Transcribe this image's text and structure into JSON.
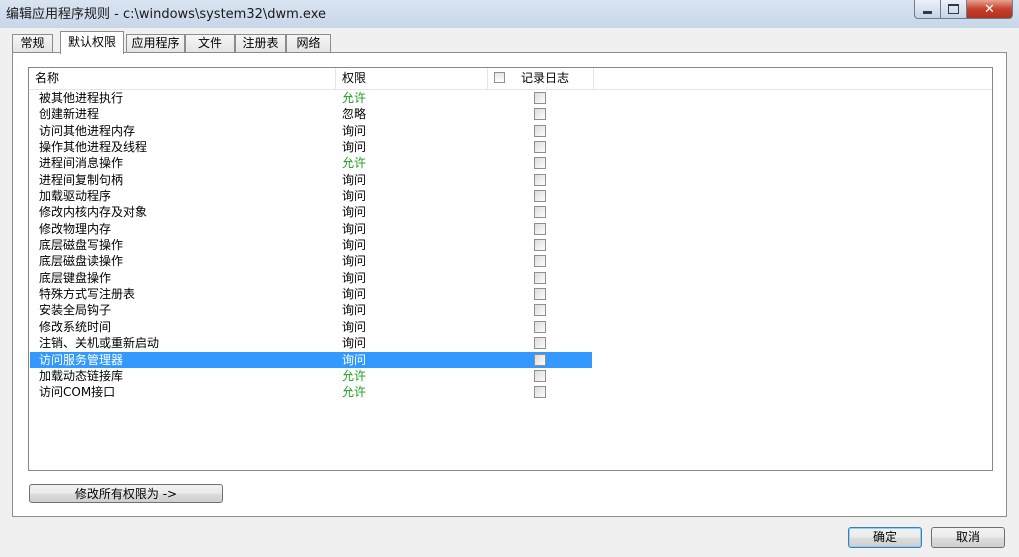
{
  "window": {
    "title": "编辑应用程序规则 - c:\\windows\\system32\\dwm.exe"
  },
  "tabs": [
    {
      "label": "常规",
      "active": false
    },
    {
      "label": "默认权限",
      "active": true
    },
    {
      "label": "应用程序",
      "active": false
    },
    {
      "label": "文件",
      "active": false
    },
    {
      "label": "注册表",
      "active": false
    },
    {
      "label": "网络",
      "active": false
    }
  ],
  "list": {
    "columns": {
      "name": "名称",
      "permission": "权限",
      "log": "记录日志"
    },
    "rows": [
      {
        "name": "被其他进程执行",
        "permission": "允许",
        "allow": true,
        "selected": false
      },
      {
        "name": "创建新进程",
        "permission": "忽略",
        "allow": false,
        "selected": false
      },
      {
        "name": "访问其他进程内存",
        "permission": "询问",
        "allow": false,
        "selected": false
      },
      {
        "name": "操作其他进程及线程",
        "permission": "询问",
        "allow": false,
        "selected": false
      },
      {
        "name": "进程间消息操作",
        "permission": "允许",
        "allow": true,
        "selected": false
      },
      {
        "name": "进程间复制句柄",
        "permission": "询问",
        "allow": false,
        "selected": false
      },
      {
        "name": "加载驱动程序",
        "permission": "询问",
        "allow": false,
        "selected": false
      },
      {
        "name": "修改内核内存及对象",
        "permission": "询问",
        "allow": false,
        "selected": false
      },
      {
        "name": "修改物理内存",
        "permission": "询问",
        "allow": false,
        "selected": false
      },
      {
        "name": "底层磁盘写操作",
        "permission": "询问",
        "allow": false,
        "selected": false
      },
      {
        "name": "底层磁盘读操作",
        "permission": "询问",
        "allow": false,
        "selected": false
      },
      {
        "name": "底层键盘操作",
        "permission": "询问",
        "allow": false,
        "selected": false
      },
      {
        "name": "特殊方式写注册表",
        "permission": "询问",
        "allow": false,
        "selected": false
      },
      {
        "name": "安装全局钩子",
        "permission": "询问",
        "allow": false,
        "selected": false
      },
      {
        "name": "修改系统时间",
        "permission": "询问",
        "allow": false,
        "selected": false
      },
      {
        "name": "注销、关机或重新启动",
        "permission": "询问",
        "allow": false,
        "selected": false
      },
      {
        "name": "访问服务管理器",
        "permission": "询问",
        "allow": false,
        "selected": true
      },
      {
        "name": "加载动态链接库",
        "permission": "允许",
        "allow": true,
        "selected": false
      },
      {
        "name": "访问COM接口",
        "permission": "允许",
        "allow": true,
        "selected": false
      }
    ]
  },
  "buttons": {
    "modify_all": "修改所有权限为 ->",
    "ok": "确定",
    "cancel": "取消"
  },
  "colors": {
    "allow": "#1e9e1e",
    "selection": "#3399ff"
  },
  "icons": {
    "minimize": "minimize-icon",
    "maximize": "maximize-icon",
    "close": "close-icon"
  }
}
